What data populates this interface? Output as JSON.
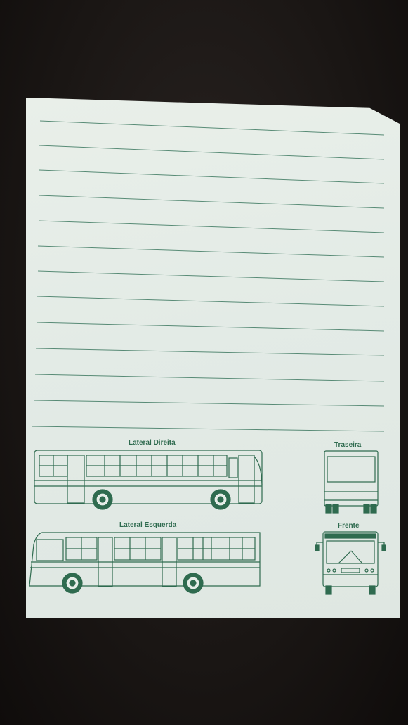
{
  "photo": {
    "subject": "lined paper sheet with bus diagrams",
    "background_color": "#1a1614",
    "paper_color": "#e6ede8",
    "ink_color": "#2f6b4f",
    "line_count": 13
  },
  "labels": {
    "right_side": "Lateral Direita",
    "rear": "Traseira",
    "left_side": "Lateral Esquerda",
    "front": "Frente"
  }
}
